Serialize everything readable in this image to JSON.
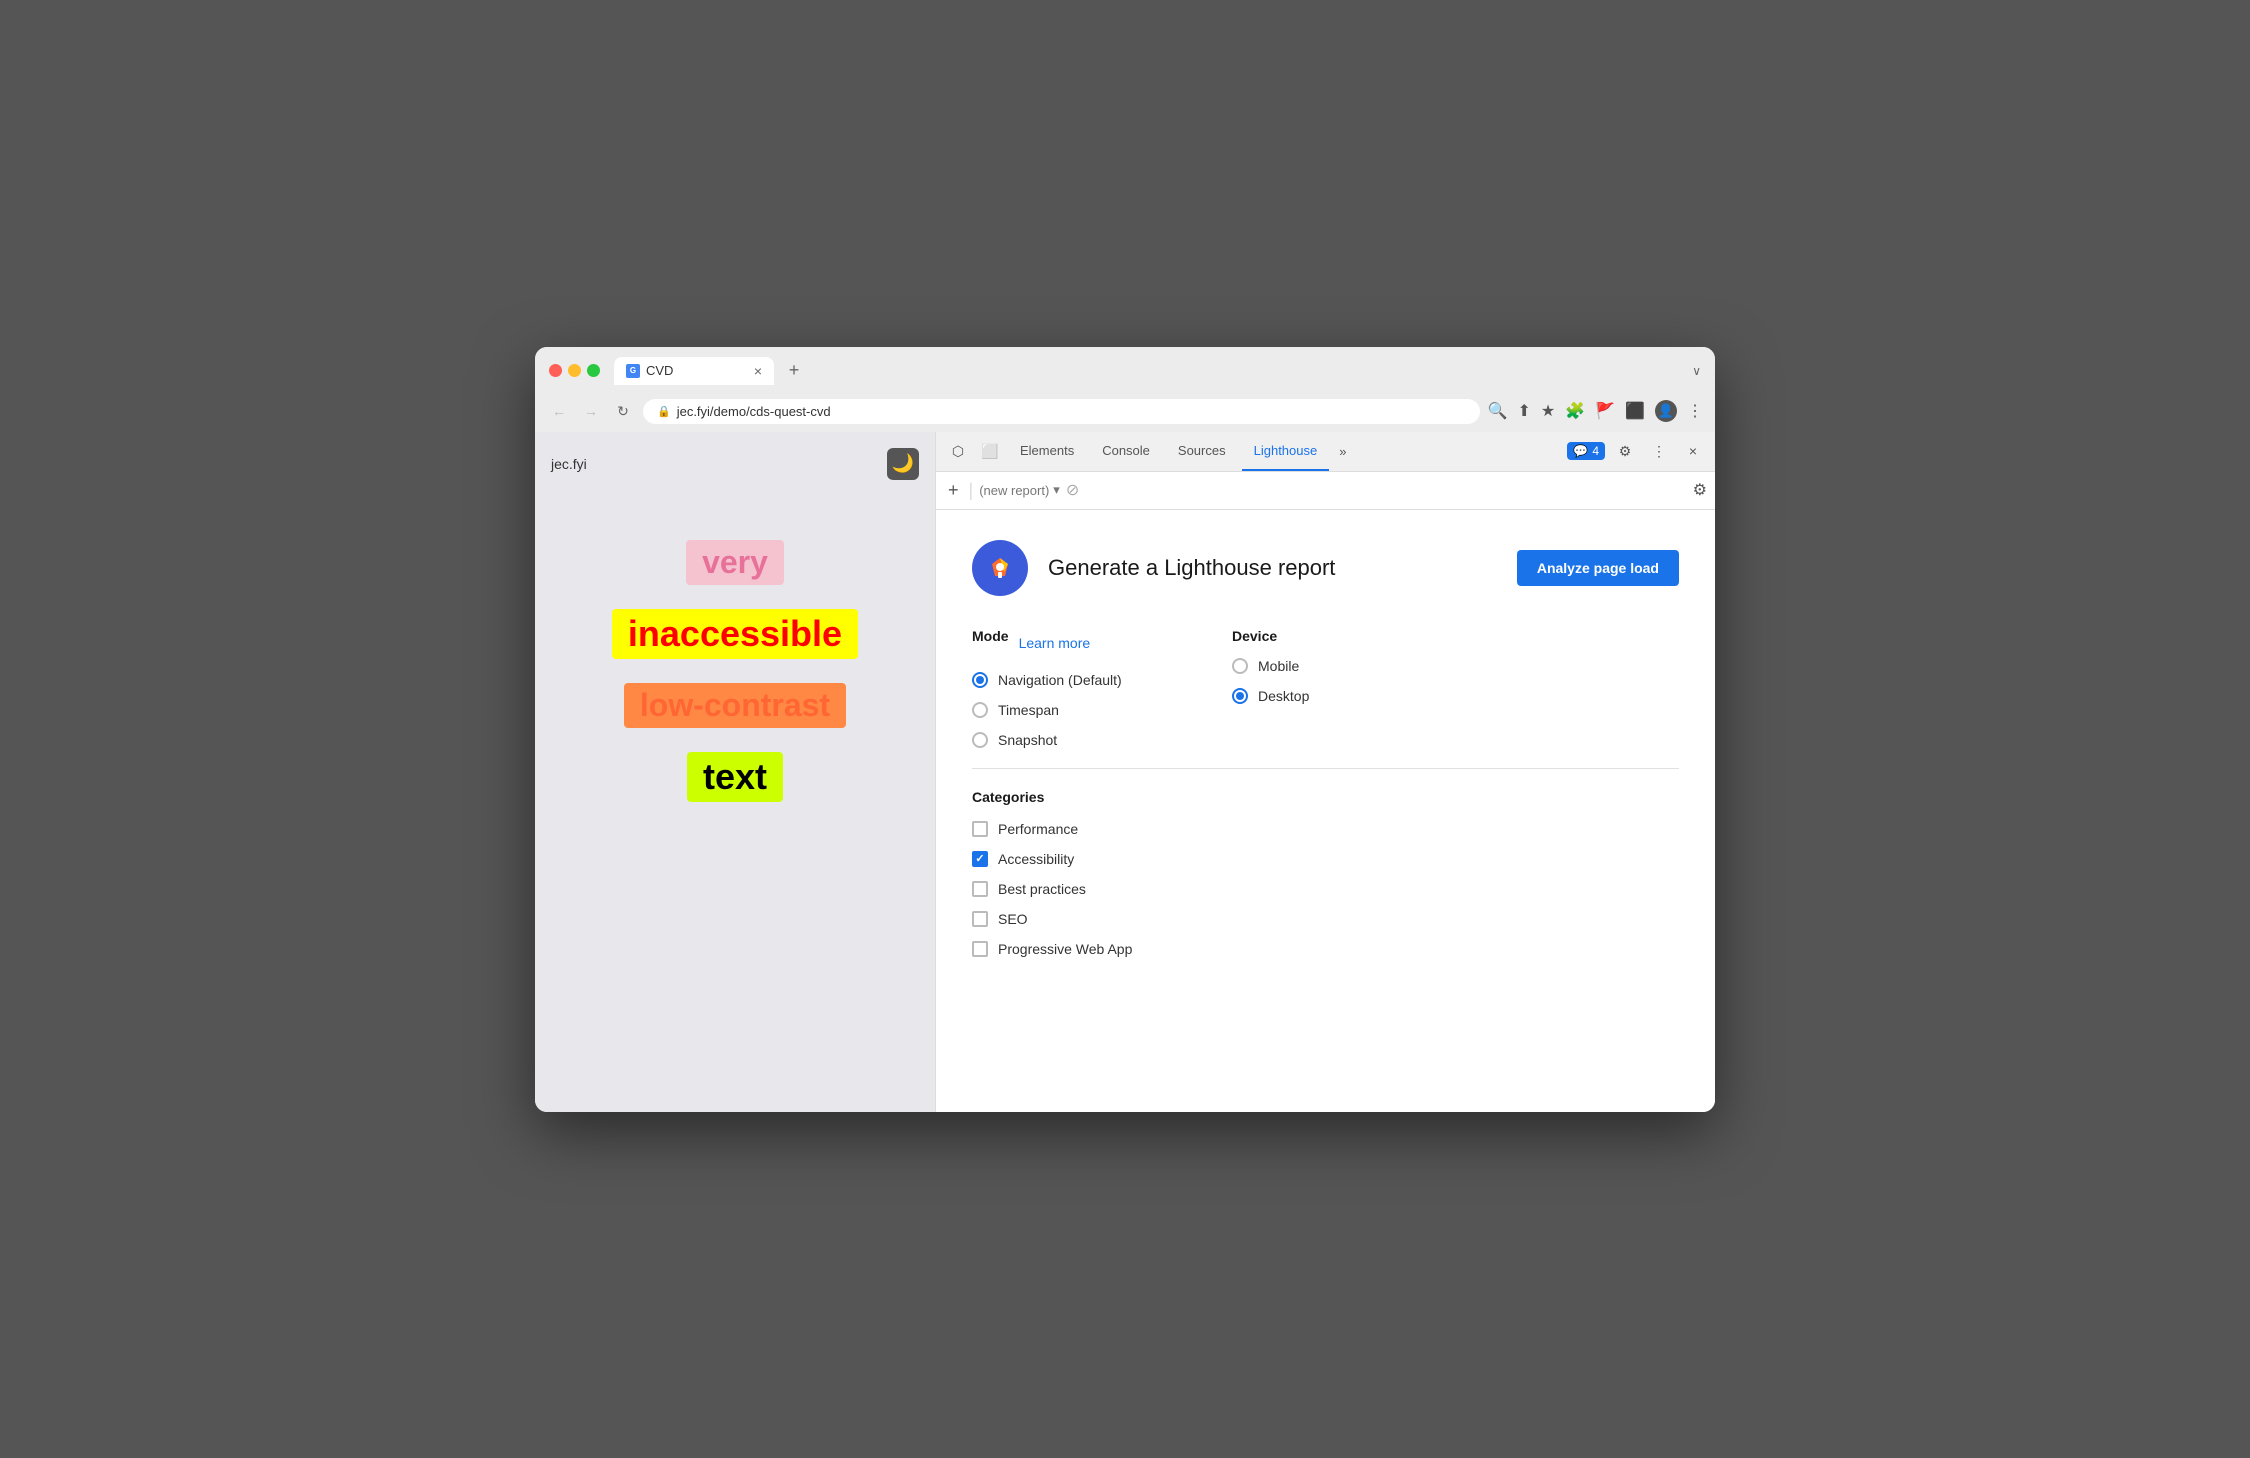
{
  "browser": {
    "tab_title": "CVD",
    "tab_close": "×",
    "new_tab": "+",
    "tab_overflow": "∨",
    "back": "←",
    "forward": "→",
    "reload": "↻",
    "url": "jec.fyi/demo/cds-quest-cvd",
    "toolbar_icons": [
      "🔍",
      "⬆",
      "★",
      "🧩",
      "🚩",
      "⬛",
      "👤",
      "⋮"
    ]
  },
  "devtools": {
    "icon1": "⬡",
    "icon2": "⬜",
    "tabs": [
      "Elements",
      "Console",
      "Sources",
      "Lighthouse"
    ],
    "active_tab": "Lighthouse",
    "overflow": "»",
    "badge_icon": "💬",
    "badge_count": "4",
    "gear": "⚙",
    "more": "⋮",
    "close": "×",
    "add_report": "+",
    "report_placeholder": "(new report)",
    "dropdown_arrow": "▾",
    "no_entry": "⊘",
    "settings_gear": "⚙"
  },
  "webpage": {
    "title": "jec.fyi",
    "moon": "🌙",
    "words": [
      {
        "text": "very",
        "class": "word-very"
      },
      {
        "text": "inaccessible",
        "class": "word-inaccessible"
      },
      {
        "text": "low-contrast",
        "class": "word-low-contrast"
      },
      {
        "text": "text",
        "class": "word-text"
      }
    ]
  },
  "lighthouse": {
    "title": "Generate a Lighthouse report",
    "analyze_btn": "Analyze page load",
    "mode_label": "Mode",
    "learn_more": "Learn more",
    "mode_options": [
      {
        "label": "Navigation (Default)",
        "checked": true
      },
      {
        "label": "Timespan",
        "checked": false
      },
      {
        "label": "Snapshot",
        "checked": false
      }
    ],
    "device_label": "Device",
    "device_options": [
      {
        "label": "Mobile",
        "checked": false
      },
      {
        "label": "Desktop",
        "checked": true
      }
    ],
    "categories_label": "Categories",
    "categories": [
      {
        "label": "Performance",
        "checked": false
      },
      {
        "label": "Accessibility",
        "checked": true
      },
      {
        "label": "Best practices",
        "checked": false
      },
      {
        "label": "SEO",
        "checked": false
      },
      {
        "label": "Progressive Web App",
        "checked": false
      }
    ]
  }
}
